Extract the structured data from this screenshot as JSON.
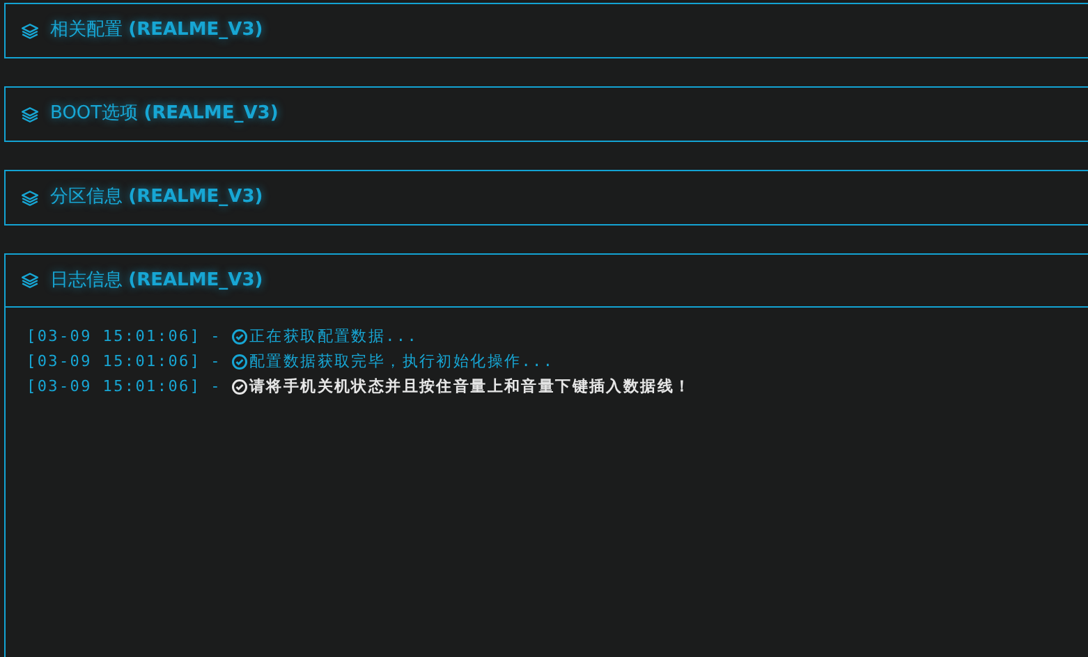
{
  "panels": [
    {
      "title": "相关配置 **(REALME_V3)**"
    },
    {
      "title": "BOOT选项 **(REALME_V3)**"
    },
    {
      "title": "分区信息 **(REALME_V3)**"
    },
    {
      "title": "日志信息 **(REALME_V3)**",
      "log": [
        {
          "time": "[03-09 15:01:06]",
          "sep": "-",
          "message": "正在获取配置数据...",
          "kind": "info"
        },
        {
          "time": "[03-09 15:01:06]",
          "sep": "-",
          "message": "配置数据获取完毕，执行初始化操作...",
          "kind": "info"
        },
        {
          "time": "[03-09 15:01:06]",
          "sep": "-",
          "message": "请将手机关机状态并且按住音量上和音量下键插入数据线！",
          "kind": "alert"
        }
      ]
    }
  ]
}
